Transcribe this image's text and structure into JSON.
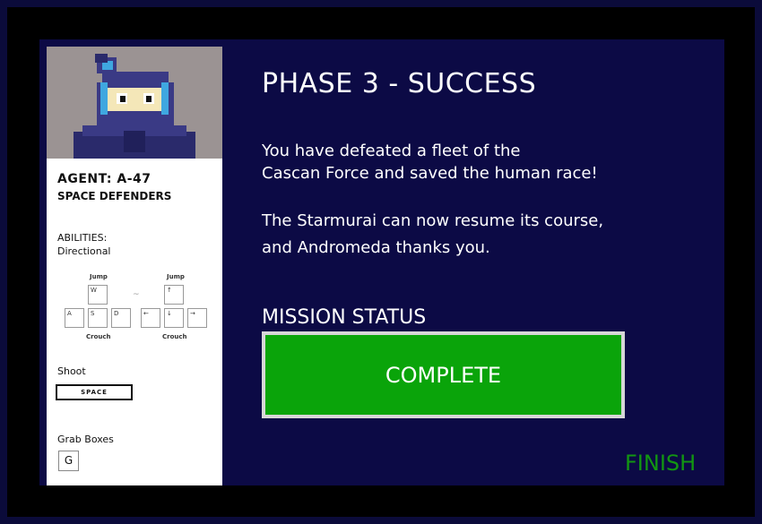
{
  "agent": {
    "name": "AGENT: A-47",
    "team": "SPACE DEFENDERS"
  },
  "abilities": {
    "title": "ABILITIES:",
    "subtitle": "Directional",
    "left_set": {
      "top_label": "Jump",
      "bottom_label": "Crouch",
      "keys": [
        "W",
        "A",
        "S",
        "D"
      ]
    },
    "right_set": {
      "top_label": "Jump",
      "bottom_label": "Crouch",
      "keys": [
        "↑",
        "←",
        "↓",
        "→"
      ]
    },
    "or_symbol": "~"
  },
  "shoot": {
    "title": "Shoot",
    "key": "SPACE"
  },
  "grab": {
    "title": "Grab Boxes",
    "key": "G"
  },
  "main": {
    "phase_title": "PHASE 3 - SUCCESS",
    "message_line1": "You have defeated a fleet of the",
    "message_line2": "Cascan Force and saved the human race!",
    "message_line3": "The Starmurai can now resume its course,",
    "message_line4": "and Andromeda thanks you.",
    "status_label": "MISSION STATUS",
    "status_value": "COMPLETE",
    "finish_label": "FINISH"
  },
  "colors": {
    "panel": "#0c0a45",
    "status_green": "#0aa40a",
    "finish_green": "#129612"
  }
}
